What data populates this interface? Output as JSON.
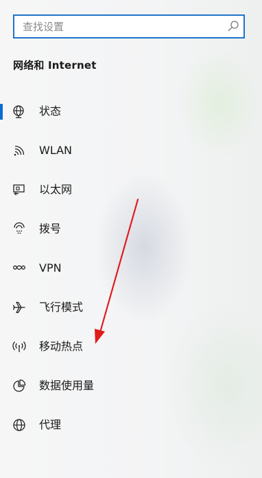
{
  "search": {
    "placeholder": "查找设置"
  },
  "section": {
    "title": "网络和 Internet"
  },
  "nav": {
    "items": [
      {
        "label": "状态",
        "icon": "globe-status-icon",
        "selected": true
      },
      {
        "label": "WLAN",
        "icon": "wifi-icon",
        "selected": false
      },
      {
        "label": "以太网",
        "icon": "ethernet-icon",
        "selected": false
      },
      {
        "label": "拨号",
        "icon": "dialup-icon",
        "selected": false
      },
      {
        "label": "VPN",
        "icon": "vpn-icon",
        "selected": false
      },
      {
        "label": "飞行模式",
        "icon": "airplane-icon",
        "selected": false
      },
      {
        "label": "移动热点",
        "icon": "hotspot-icon",
        "selected": false
      },
      {
        "label": "数据使用量",
        "icon": "data-usage-icon",
        "selected": false
      },
      {
        "label": "代理",
        "icon": "globe-icon",
        "selected": false
      }
    ]
  },
  "colors": {
    "accent": "#0a6cd4",
    "search_border": "#1f73c9",
    "annotation_arrow": "#e01b1b"
  }
}
